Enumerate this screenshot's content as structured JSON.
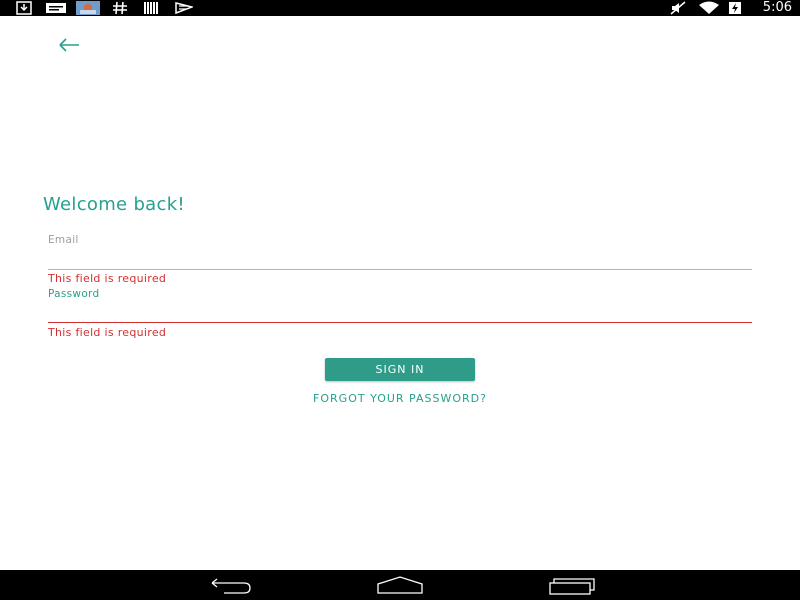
{
  "colors": {
    "accent": "#26a08f",
    "error": "#d32f2f",
    "email_line": "#e8a090",
    "muted": "#9e9e9e",
    "button_bg": "#2e9c88"
  },
  "status_bar": {
    "time": "5:06",
    "left_icons": [
      "download-icon",
      "message-icon",
      "app-thumbnail-icon",
      "hashtag-icon",
      "barcode-icon",
      "plane-icon"
    ],
    "right_icons": [
      "mute-icon",
      "wifi-icon",
      "battery-charging-icon"
    ]
  },
  "header": {
    "back_icon": "arrow-back-icon"
  },
  "form": {
    "title": "Welcome back!",
    "email": {
      "label": "Email",
      "value": "",
      "error": "This field is required"
    },
    "password": {
      "label": "Password",
      "value": "",
      "error": "This field is required"
    },
    "signin_label": "SIGN IN",
    "forgot_label": "FORGOT YOUR PASSWORD?"
  },
  "nav_bar": {
    "icons": [
      "nav-back-icon",
      "nav-home-icon",
      "nav-recents-icon"
    ]
  }
}
